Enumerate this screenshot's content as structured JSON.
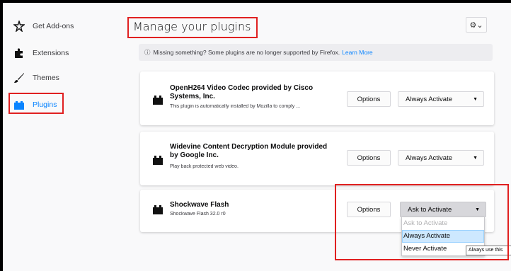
{
  "sidebar": {
    "items": [
      {
        "label": "Get Add-ons",
        "icon": "puzzle-star-icon"
      },
      {
        "label": "Extensions",
        "icon": "puzzle-piece-icon"
      },
      {
        "label": "Themes",
        "icon": "brush-icon"
      },
      {
        "label": "Plugins",
        "icon": "plugin-brick-icon",
        "selected": true
      }
    ]
  },
  "header": {
    "title": "Manage your plugins",
    "tools_glyph": "⚙⌄"
  },
  "notice": {
    "icon": "ⓘ",
    "text": "Missing something? Some plugins are no longer supported by Firefox.",
    "link": "Learn More"
  },
  "plugins": [
    {
      "name": "OpenH264 Video Codec provided by Cisco Systems, Inc.",
      "description": "This plugin is automatically installed by Mozilla to comply ...",
      "options_label": "Options",
      "state_label": "Always Activate"
    },
    {
      "name": "Widevine Content Decryption Module provided by Google Inc.",
      "description": "Play back protected web video.",
      "options_label": "Options",
      "state_label": "Always Activate"
    },
    {
      "name": "Shockwave Flash",
      "description": "Shockwave Flash 32.0 r0",
      "options_label": "Options",
      "state_label": "Ask to Activate"
    }
  ],
  "dropdown_menu": {
    "items": [
      "Ask to Activate",
      "Always Activate",
      "Never Activate"
    ]
  },
  "tooltip": "Always use this",
  "caret": "▼",
  "colors": {
    "accent": "#0a84ff",
    "highlight_border": "#e02020",
    "menu_hover": "#cde8ff"
  }
}
